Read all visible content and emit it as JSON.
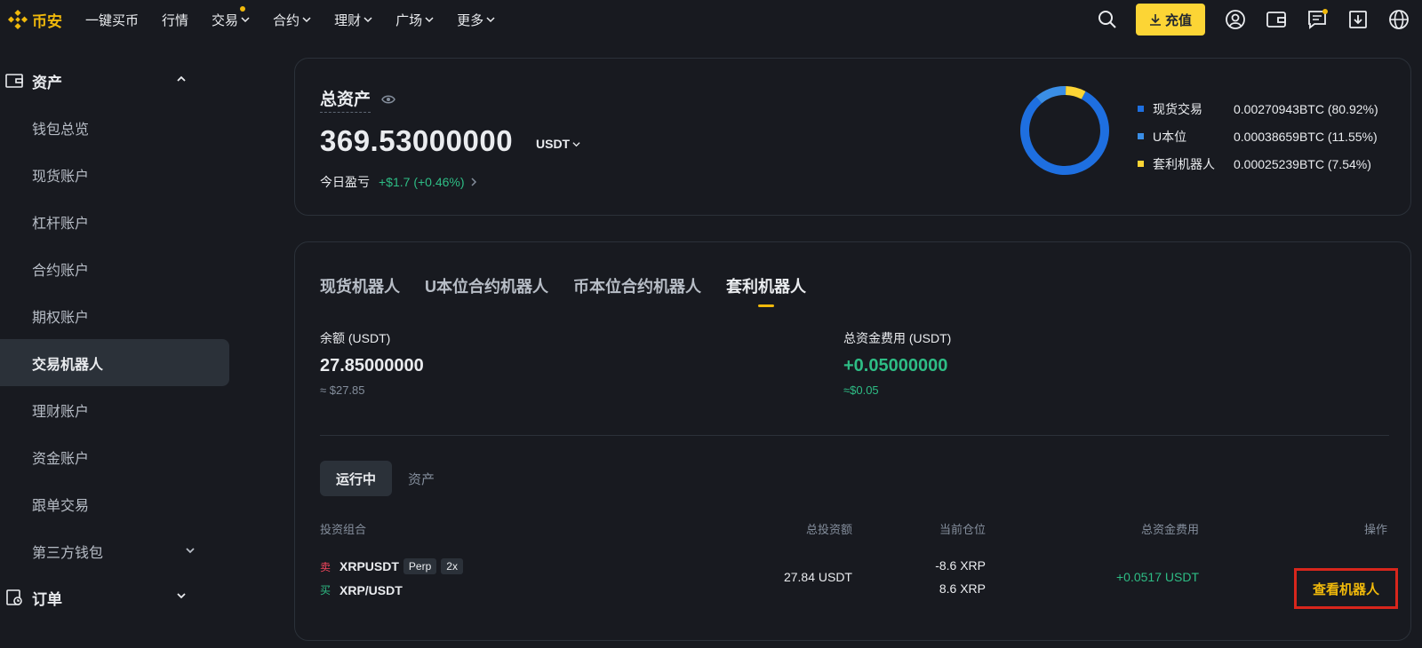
{
  "brand": {
    "name": "币安"
  },
  "nav": {
    "items": [
      {
        "label": "一键买币",
        "has_menu": false
      },
      {
        "label": "行情",
        "has_menu": false
      },
      {
        "label": "交易",
        "has_menu": true
      },
      {
        "label": "合约",
        "has_menu": true
      },
      {
        "label": "理财",
        "has_menu": true
      },
      {
        "label": "广场",
        "has_menu": true
      },
      {
        "label": "更多",
        "has_menu": true
      }
    ],
    "deposit_label": "充值",
    "icons": [
      "search-icon",
      "user-icon",
      "wallet-icon",
      "message-icon",
      "download-icon",
      "globe-icon"
    ]
  },
  "sidebar": {
    "section_label": "资产",
    "items": [
      {
        "label": "钱包总览"
      },
      {
        "label": "现货账户"
      },
      {
        "label": "杠杆账户"
      },
      {
        "label": "合约账户"
      },
      {
        "label": "期权账户"
      },
      {
        "label": "交易机器人"
      },
      {
        "label": "理财账户"
      },
      {
        "label": "资金账户"
      },
      {
        "label": "跟单交易"
      },
      {
        "label": "第三方钱包"
      }
    ],
    "active_item": "交易机器人",
    "orders_label": "订单"
  },
  "summary": {
    "title": "总资产",
    "value": "369.53000000",
    "currency": "USDT",
    "pnl_label": "今日盈亏",
    "pnl_value": "+$1.7 (+0.46%)",
    "allocation": [
      {
        "name": "现货交易",
        "value": "0.00270943BTC (80.92%)",
        "percent": 80.92,
        "color": "#1e6fe0"
      },
      {
        "name": "U本位",
        "value": "0.00038659BTC (11.55%)",
        "percent": 11.55,
        "color": "#3a8ee6"
      },
      {
        "name": "套利机器人",
        "value": "0.00025239BTC (7.54%)",
        "percent": 7.54,
        "color": "#fcd535"
      }
    ]
  },
  "bots": {
    "tabs": [
      "现货机器人",
      "U本位合约机器人",
      "币本位合约机器人",
      "套利机器人"
    ],
    "active_tab": "套利机器人",
    "balance_label": "余额 (USDT)",
    "balance_value": "27.85000000",
    "balance_sub": "≈ $27.85",
    "funding_label": "总资金费用 (USDT)",
    "funding_value": "+0.05000000",
    "funding_sub": "≈$0.05",
    "sub_tabs": [
      "运行中",
      "资产"
    ],
    "active_sub_tab": "运行中",
    "table": {
      "headers": [
        "投资组合",
        "总投资额",
        "当前仓位",
        "总资金费用",
        "操作"
      ],
      "rows": [
        {
          "legs": [
            {
              "side": "卖",
              "pair": "XRPUSDT",
              "badges": [
                "Perp",
                "2x"
              ]
            },
            {
              "side": "买",
              "pair": "XRP/USDT",
              "badges": []
            }
          ],
          "total_investment": "27.84 USDT",
          "positions": [
            "-8.6 XRP",
            "8.6 XRP"
          ],
          "funding": "+0.0517 USDT",
          "action": "查看机器人"
        }
      ]
    }
  }
}
